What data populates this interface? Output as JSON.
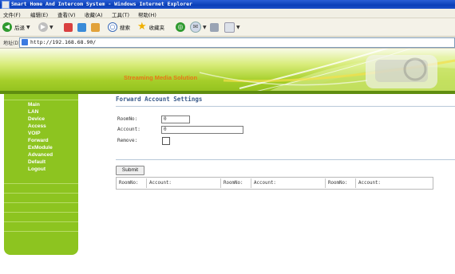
{
  "window": {
    "title": "Smart Home And Intercom System - Windows Internet Explorer"
  },
  "menu": {
    "items": [
      "文件(F)",
      "编辑(E)",
      "查看(V)",
      "收藏(A)",
      "工具(T)",
      "帮助(H)"
    ]
  },
  "toolbar": {
    "back_label": "后退",
    "search_label": "搜索",
    "favorites_label": "收藏夹"
  },
  "address": {
    "label": "地址(D)",
    "url": "http://192.168.68.90/"
  },
  "banner": {
    "title": "Streaming Media Solution"
  },
  "sidebar": {
    "items": [
      "Main",
      "LAN",
      "Device",
      "Access",
      "VOIP",
      "Forward",
      "ExModule",
      "Advanced",
      "Default",
      "Logout"
    ]
  },
  "main": {
    "title": "Forward Account Settings",
    "fields": {
      "roomno_label": "RoomNo:",
      "roomno_value": "0",
      "account_label": "Account:",
      "account_value": "0",
      "remove_label": "Remove:"
    },
    "submit_label": "Submit",
    "table": {
      "headers": [
        "RoomNo:",
        "Account:",
        "RoomNo:",
        "Account:",
        "RoomNo:",
        "Account:"
      ]
    }
  },
  "colors": {
    "sidebar_bg": "#8dc420",
    "banner_title": "#e8741a",
    "page_title": "#3a5a8a"
  }
}
